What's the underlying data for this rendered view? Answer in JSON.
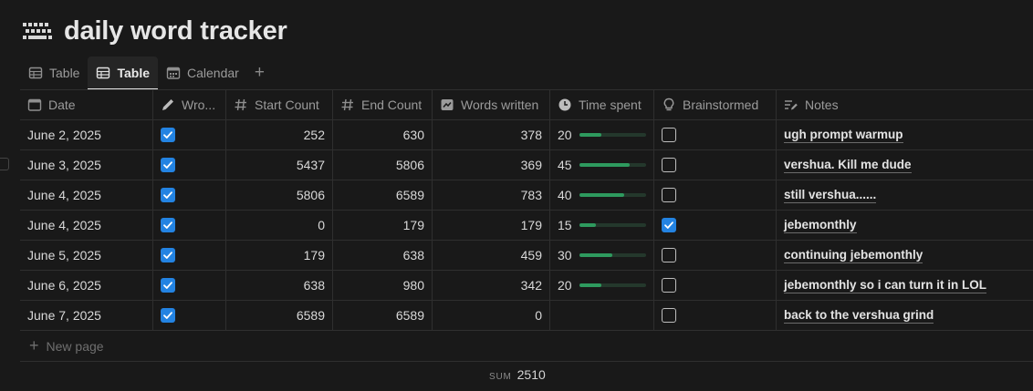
{
  "page": {
    "title": "daily word tracker",
    "title_icon": "keyboard-icon"
  },
  "tabs": [
    {
      "label": "Table",
      "icon": "table-icon",
      "active": false
    },
    {
      "label": "Table",
      "icon": "table-icon",
      "active": true
    },
    {
      "label": "Calendar",
      "icon": "calendar-icon",
      "active": false
    }
  ],
  "tab_add": "+",
  "columns": {
    "date": "Date",
    "wrote": "Wro...",
    "start": "Start Count",
    "end": "End Count",
    "words": "Words written",
    "time": "Time spent",
    "brainstormed": "Brainstormed",
    "notes": "Notes"
  },
  "rows": [
    {
      "date": "June 2, 2025",
      "wrote": true,
      "start": "252",
      "end": "630",
      "words": "378",
      "time": "20",
      "time_fraction": 0.33,
      "brainstormed": false,
      "notes": "ugh prompt warmup"
    },
    {
      "date": "June 3, 2025",
      "wrote": true,
      "start": "5437",
      "end": "5806",
      "words": "369",
      "time": "45",
      "time_fraction": 0.75,
      "brainstormed": false,
      "notes": "vershua. Kill me dude"
    },
    {
      "date": "June 4, 2025",
      "wrote": true,
      "start": "5806",
      "end": "6589",
      "words": "783",
      "time": "40",
      "time_fraction": 0.67,
      "brainstormed": false,
      "notes": "still vershua......"
    },
    {
      "date": "June 4, 2025",
      "wrote": true,
      "start": "0",
      "end": "179",
      "words": "179",
      "time": "15",
      "time_fraction": 0.25,
      "brainstormed": true,
      "notes": "jebemonthly"
    },
    {
      "date": "June 5, 2025",
      "wrote": true,
      "start": "179",
      "end": "638",
      "words": "459",
      "time": "30",
      "time_fraction": 0.5,
      "brainstormed": false,
      "notes": "continuing jebemonthly"
    },
    {
      "date": "June 6, 2025",
      "wrote": true,
      "start": "638",
      "end": "980",
      "words": "342",
      "time": "20",
      "time_fraction": 0.33,
      "brainstormed": false,
      "notes": "jebemonthly so i can turn it in LOL"
    },
    {
      "date": "June 7, 2025",
      "wrote": true,
      "start": "6589",
      "end": "6589",
      "words": "0",
      "time": "",
      "time_fraction": 0,
      "brainstormed": false,
      "notes": "back to the vershua grind"
    }
  ],
  "new_page": "New page",
  "footer": {
    "sum_label": "SUM",
    "sum_value": "2510"
  },
  "colors": {
    "background": "#191919",
    "checkbox": "#2383e2",
    "progress": "#2e9a5e"
  }
}
